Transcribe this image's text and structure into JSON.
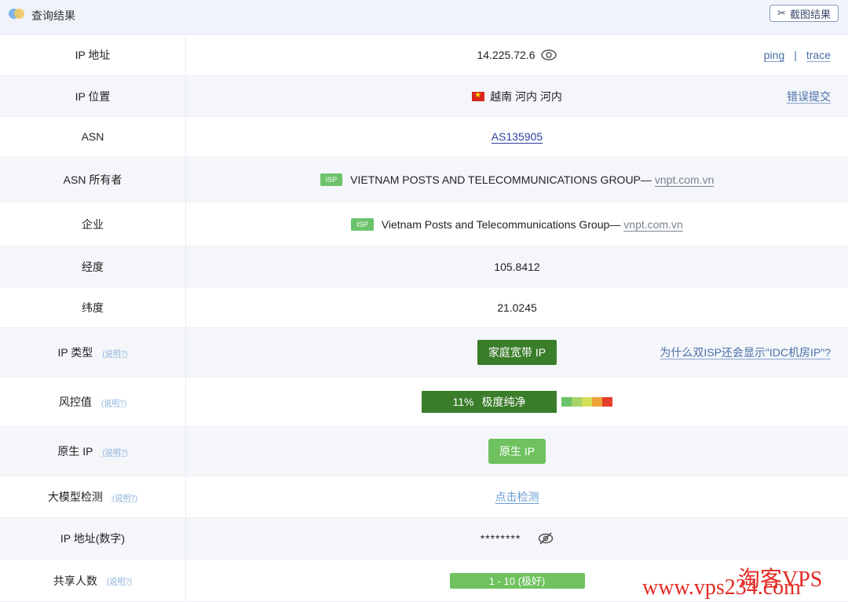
{
  "header": {
    "title": "查询结果",
    "screenshot_label": "截图结果"
  },
  "rows": [
    {
      "label": "IP 地址",
      "value": "14.225.72.6",
      "links": [
        "ping",
        "|",
        "trace"
      ]
    },
    {
      "label": "IP 位置",
      "value": "越南 河内 河内",
      "link": "错误提交"
    },
    {
      "label": "ASN",
      "value": "AS135905"
    },
    {
      "label": "ASN 所有者",
      "badge": "ISP",
      "value": "VIETNAM POSTS AND TELECOMMUNICATIONS GROUP—",
      "domain": "vnpt.com.vn"
    },
    {
      "label": "企业",
      "badge": "ISP",
      "value": "Vietnam Posts and Telecommunications Group—",
      "domain": "vnpt.com.vn"
    },
    {
      "label": "经度",
      "value": "105.8412"
    },
    {
      "label": "纬度",
      "value": "21.0245"
    },
    {
      "label": "IP 类型",
      "help": "(说明?)",
      "value": "家庭宽带 IP",
      "link": "为什么双ISP还会显示\"IDC机房IP\"?"
    },
    {
      "label": "风控值",
      "help": "(说明?)",
      "score": "11%",
      "value": "极度纯净"
    },
    {
      "label": "原生 IP",
      "help": "(说明?)",
      "value": "原生 IP"
    },
    {
      "label": "大模型检测",
      "help": "(说明?)",
      "value": "点击检测"
    },
    {
      "label": "IP 地址(数字)",
      "value": "********"
    },
    {
      "label": "共享人数",
      "help": "(说明?)",
      "value": "1 - 10 (极好)"
    }
  ],
  "risk_scale_colors": [
    "#6cc36b",
    "#a8d46a",
    "#d6df5a",
    "#f0a33a",
    "#e5402a"
  ],
  "watermark": {
    "cn": "淘客VPS",
    "url": "www.vps234.com"
  }
}
